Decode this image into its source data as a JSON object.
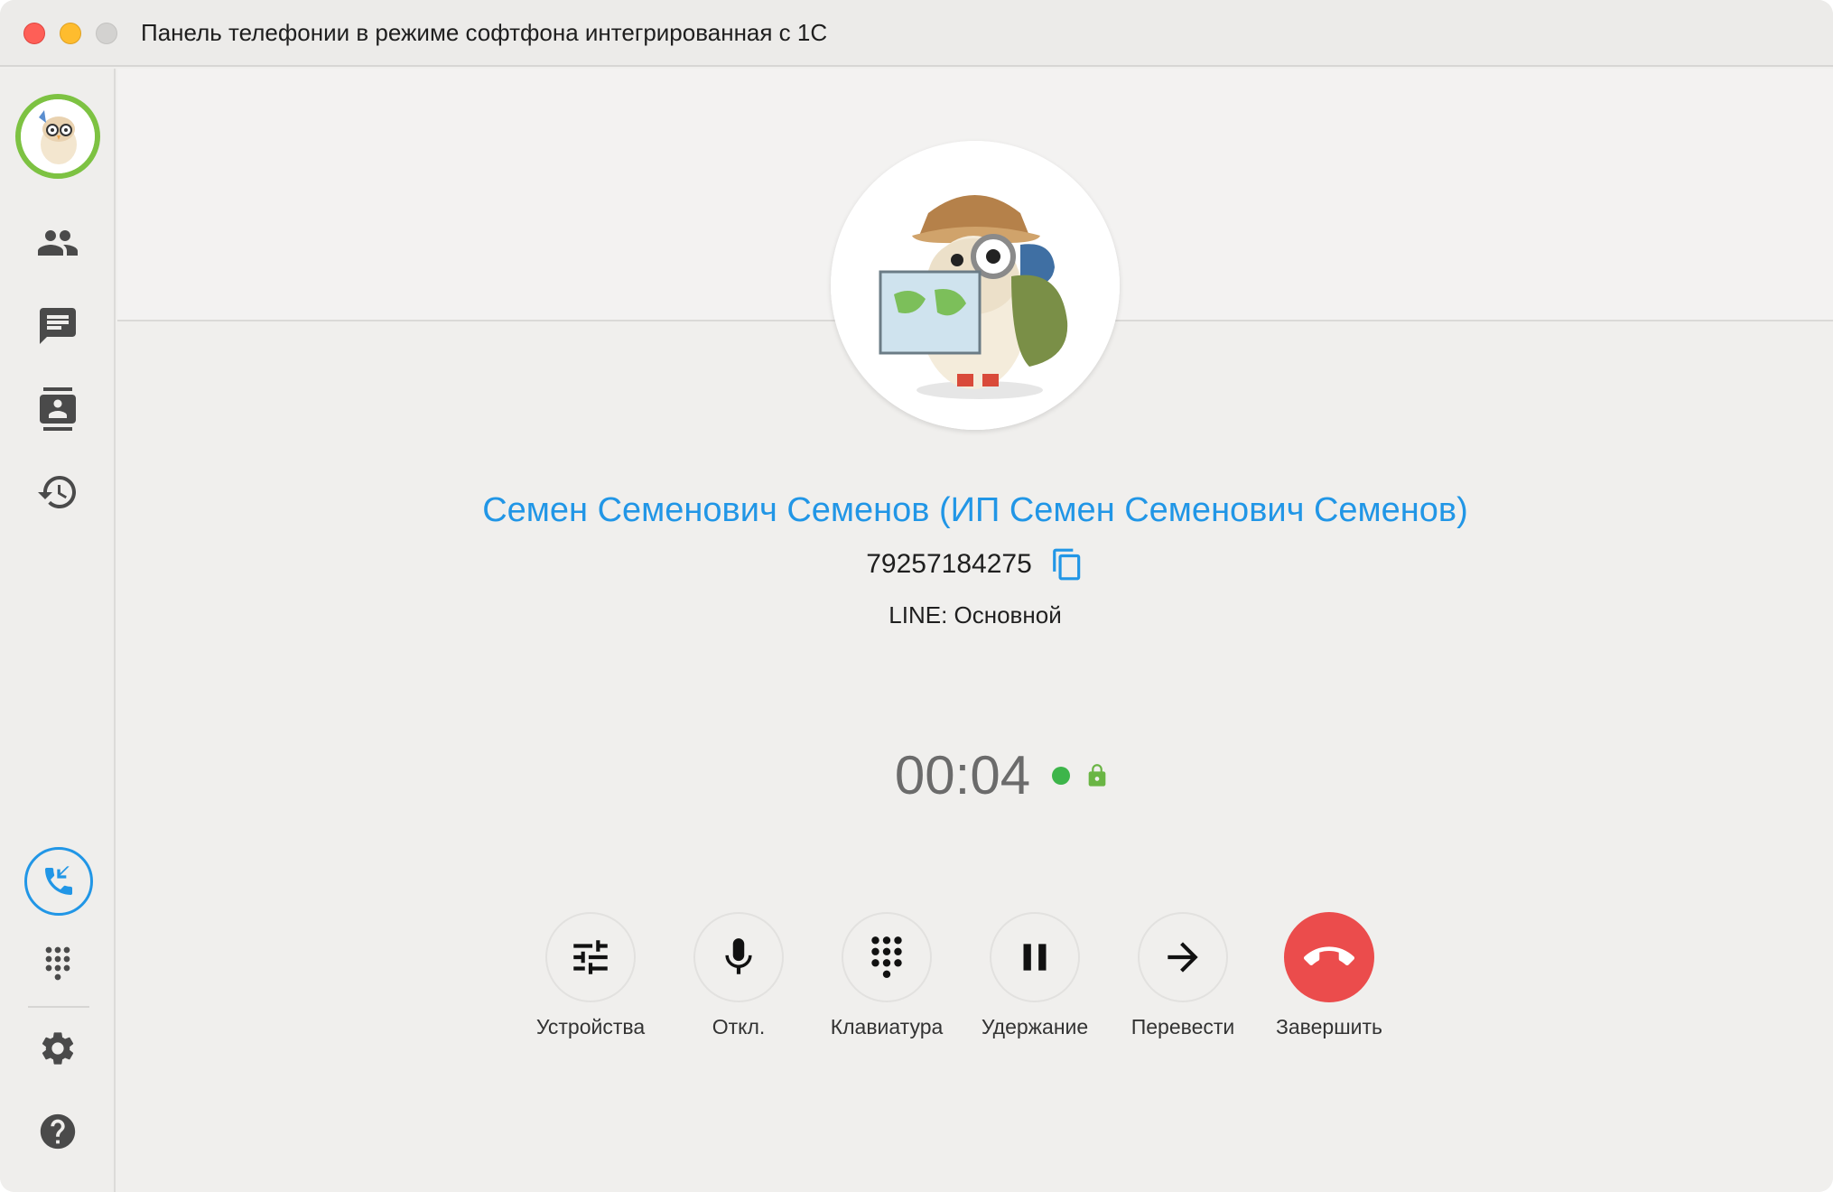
{
  "window": {
    "title": "Панель телефонии в режиме софтфона интегрированная с 1С"
  },
  "sidebar": {
    "items": [
      {
        "name": "contacts",
        "icon": "people-icon"
      },
      {
        "name": "messages",
        "icon": "chat-icon"
      },
      {
        "name": "address-book",
        "icon": "contact-card-icon"
      },
      {
        "name": "history",
        "icon": "history-icon"
      }
    ],
    "bottom": [
      {
        "name": "active-call",
        "icon": "phone-callback-icon"
      },
      {
        "name": "dialpad",
        "icon": "dialpad-icon"
      },
      {
        "name": "settings",
        "icon": "gear-icon"
      },
      {
        "name": "help",
        "icon": "help-icon"
      }
    ]
  },
  "call": {
    "contact_name": "Семен Семенович Семенов (ИП Семен Семенович Семенов)",
    "phone_number": "79257184275",
    "line": "LINE: Основной",
    "duration": "00:04",
    "status_color": "#3db54a"
  },
  "controls": {
    "devices": "Устройства",
    "mute": "Откл.",
    "keypad": "Клавиатура",
    "hold": "Удержание",
    "transfer": "Перевести",
    "end": "Завершить"
  },
  "colors": {
    "accent": "#2196e6",
    "end_call": "#eb4c4c",
    "avatar_ring": "#7dc242"
  }
}
